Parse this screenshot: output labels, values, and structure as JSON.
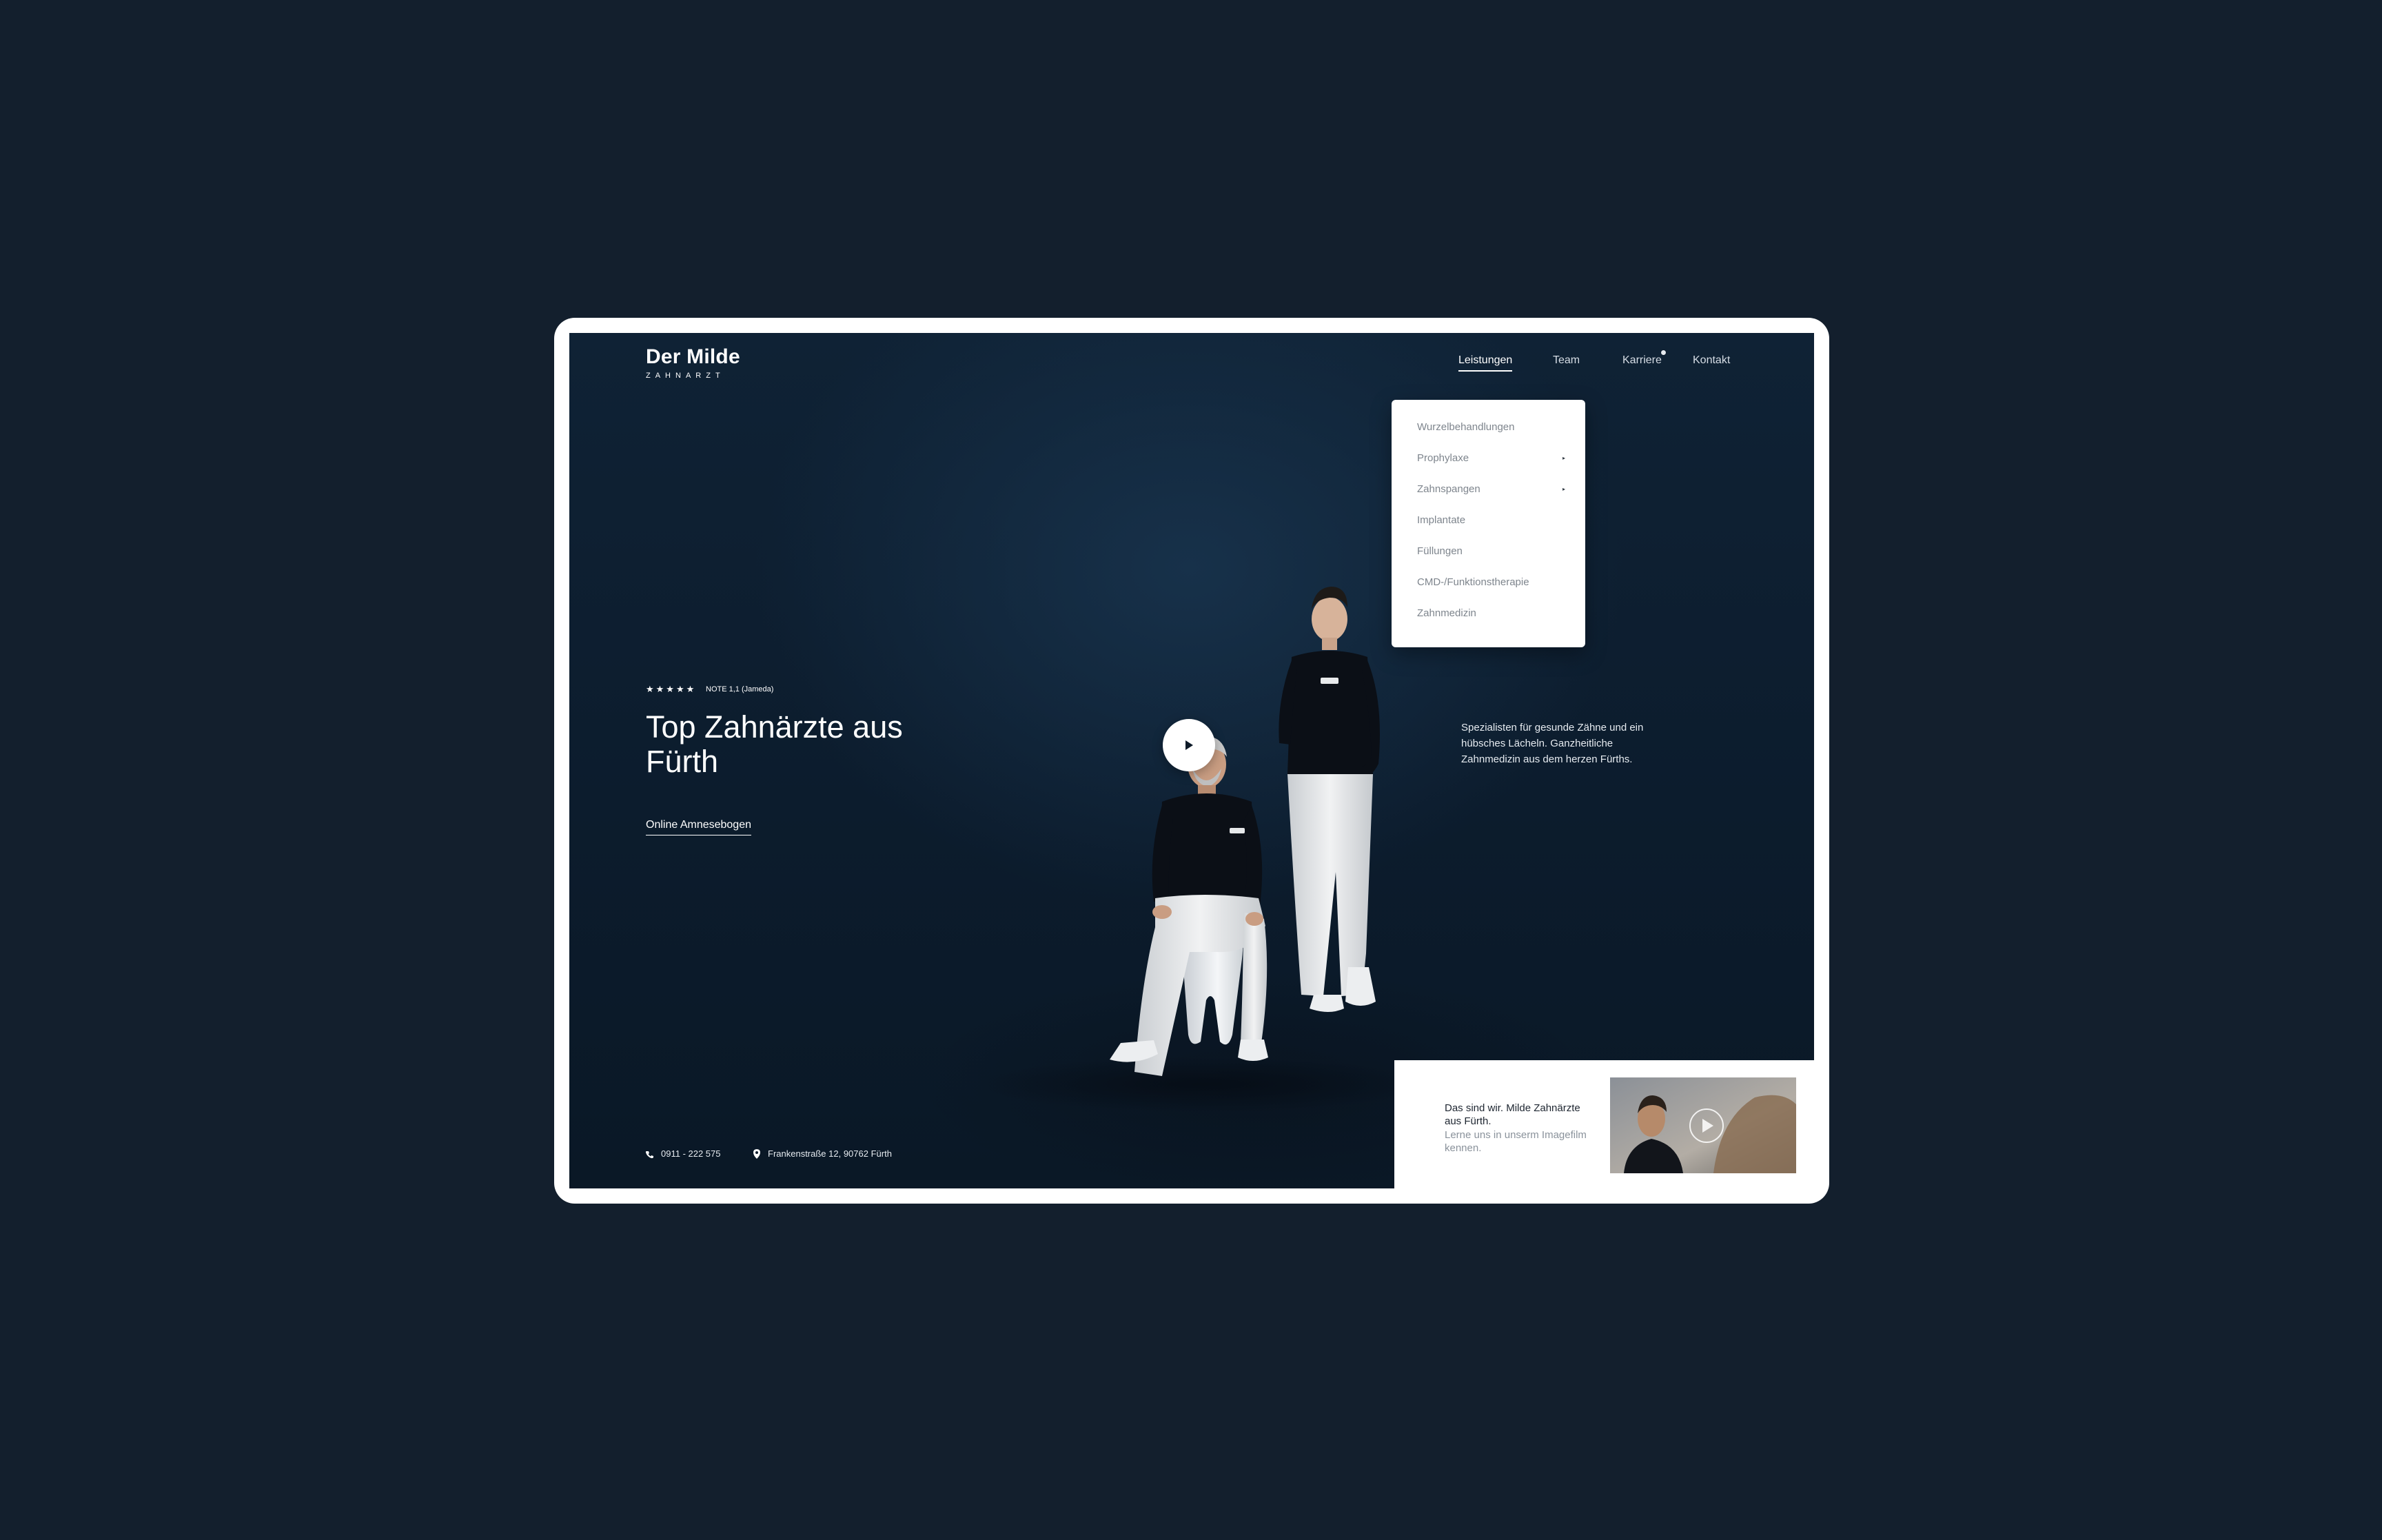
{
  "brand": {
    "name": "Der Milde",
    "subtitle": "ZAHNARZT"
  },
  "nav": {
    "items": [
      {
        "label": "Leistungen",
        "active": true
      },
      {
        "label": "Team"
      },
      {
        "label": "Karriere",
        "badge": true
      },
      {
        "label": "Kontakt"
      }
    ]
  },
  "services_menu": {
    "items": [
      {
        "label": "Wurzelbehandlungen"
      },
      {
        "label": "Prophylaxe",
        "has_submenu": true
      },
      {
        "label": "Zahnspangen",
        "has_submenu": true
      },
      {
        "label": "Implantate"
      },
      {
        "label": "Füllungen"
      },
      {
        "label": "CMD-/Funktionstherapie"
      },
      {
        "label": "Zahnmedizin"
      }
    ],
    "arrow": "▸"
  },
  "rating": {
    "stars": "★★★★★",
    "text": "NOTE 1,1  (Jameda)"
  },
  "hero": {
    "title": "Top Zahnärzte aus Fürth",
    "cta": "Online Amnesebogen"
  },
  "tagline": "Spezialisten für gesunde Zähne und ein hübsches Lächeln. Ganzheitliche Zahnmedizin aus dem herzen Fürths.",
  "contact": {
    "phone": "0911 - 222 575",
    "address": "Frankenstraße 12, 90762 Fürth"
  },
  "video_card": {
    "title": "Das sind wir. Milde Zahnärzte aus Fürth.",
    "subtitle": "Lerne uns in unserm Imagefilm kennen."
  },
  "colors": {
    "page_bg": "#131f2d",
    "hero_bg": "#0c1c2d",
    "accent": "#ffffff",
    "menu_text": "#7e858d"
  }
}
